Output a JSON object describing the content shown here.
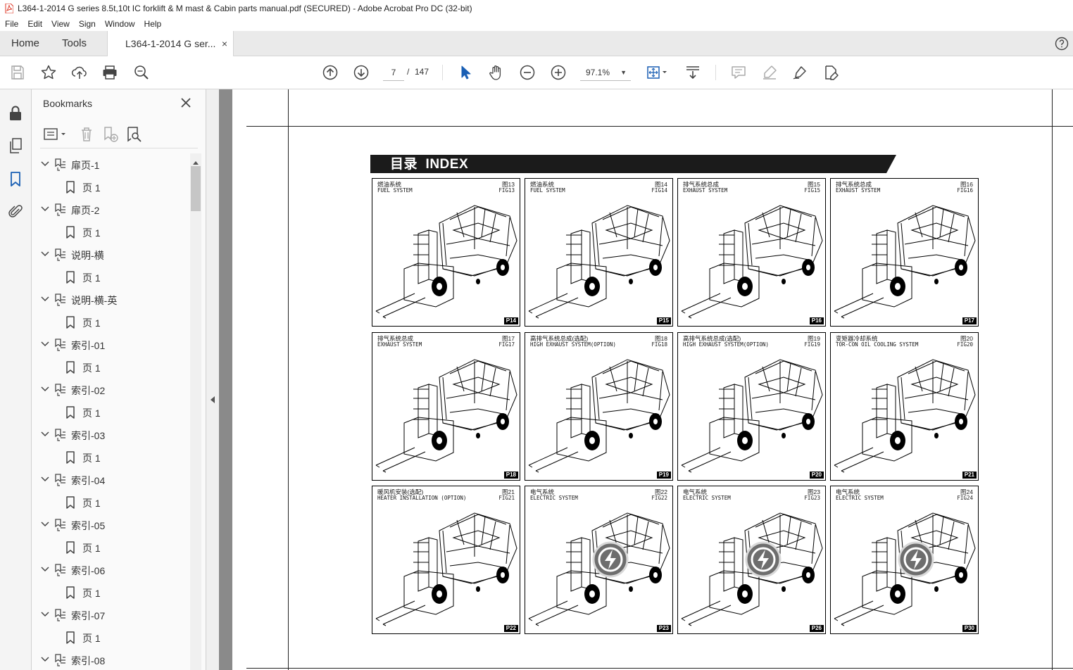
{
  "window": {
    "title": "L364-1-2014 G series 8.5t,10t IC forklift & M mast & Cabin parts manual.pdf (SECURED) - Adobe Acrobat Pro DC (32-bit)"
  },
  "menu": [
    "File",
    "Edit",
    "View",
    "Sign",
    "Window",
    "Help"
  ],
  "tabs": {
    "home": "Home",
    "tools": "Tools",
    "doc": "L364-1-2014 G ser...",
    "doc_close": "×"
  },
  "toolbar": {
    "page_current": "7",
    "page_separator": "/",
    "page_total": "147",
    "zoom": "97.1%"
  },
  "bookmarks": {
    "title": "Bookmarks",
    "items": [
      {
        "label": "扉页-1",
        "child": "页 1"
      },
      {
        "label": "扉页-2",
        "child": "页 1"
      },
      {
        "label": "说明-横",
        "child": "页 1"
      },
      {
        "label": "说明-横-英",
        "child": "页 1"
      },
      {
        "label": "索引-01",
        "child": "页 1"
      },
      {
        "label": "索引-02",
        "child": "页 1"
      },
      {
        "label": "索引-03",
        "child": "页 1"
      },
      {
        "label": "索引-04",
        "child": "页 1"
      },
      {
        "label": "索引-05",
        "child": "页 1"
      },
      {
        "label": "索引-06",
        "child": "页 1"
      },
      {
        "label": "索引-07",
        "child": "页 1"
      },
      {
        "label": "索引-08",
        "child": ""
      }
    ]
  },
  "document": {
    "index_title": "目录  INDEX",
    "figures": [
      {
        "cn": "燃油系统",
        "en": "FUEL SYSTEM",
        "fig_cn": "图13",
        "fig_en": "FIG13",
        "page": "P14",
        "electric": false
      },
      {
        "cn": "燃油系统",
        "en": "FUEL SYSTEM",
        "fig_cn": "图14",
        "fig_en": "FIG14",
        "page": "P15",
        "electric": false
      },
      {
        "cn": "排气系统总成",
        "en": "EXHAUST SYSTEM",
        "fig_cn": "图15",
        "fig_en": "FIG15",
        "page": "P16",
        "electric": false
      },
      {
        "cn": "排气系统总成",
        "en": "EXHAUST SYSTEM",
        "fig_cn": "图16",
        "fig_en": "FIG16",
        "page": "P17",
        "electric": false
      },
      {
        "cn": "排气系统总成",
        "en": "EXHAUST SYSTEM",
        "fig_cn": "图17",
        "fig_en": "FIG17",
        "page": "P18",
        "electric": false
      },
      {
        "cn": "高排气系统总成(选配)",
        "en": "HIGH EXHAUST SYSTEM(OPTION)",
        "fig_cn": "图18",
        "fig_en": "FIG18",
        "page": "P19",
        "electric": false
      },
      {
        "cn": "高排气系统总成(选配)",
        "en": "HIGH EXHAUST SYSTEM(OPTION)",
        "fig_cn": "图19",
        "fig_en": "FIG19",
        "page": "P20",
        "electric": false
      },
      {
        "cn": "变矩器冷却系统",
        "en": "TOR-CON OIL COOLING SYSTEM",
        "fig_cn": "图20",
        "fig_en": "FIG20",
        "page": "P21",
        "electric": false
      },
      {
        "cn": "暖风机安装(选配)",
        "en": "HEATER INSTALLATION (OPTION)",
        "fig_cn": "图21",
        "fig_en": "FIG21",
        "page": "P22",
        "electric": false
      },
      {
        "cn": "电气系统",
        "en": "ELECTRIC SYSTEM",
        "fig_cn": "图22",
        "fig_en": "FIG22",
        "page": "P23",
        "electric": true
      },
      {
        "cn": "电气系统",
        "en": "ELECTRIC SYSTEM",
        "fig_cn": "图23",
        "fig_en": "FIG23",
        "page": "P26",
        "electric": true
      },
      {
        "cn": "电气系统",
        "en": "ELECTRIC SYSTEM",
        "fig_cn": "图24",
        "fig_en": "FIG24",
        "page": "P30",
        "electric": true
      }
    ]
  },
  "icons": {
    "save": "save-icon",
    "star": "bookmark-star-icon",
    "upload": "upload-icon",
    "print": "print-icon",
    "search": "zoom-search-icon",
    "prev": "previous-page-icon",
    "next": "next-page-icon",
    "select": "select-cursor-icon",
    "hand": "hand-tool-icon",
    "zoom_out": "zoom-out-icon",
    "zoom_in": "zoom-in-icon",
    "fit": "fit-page-icon",
    "scroll": "scroll-mode-icon",
    "comment": "comment-icon",
    "highlight": "highlight-icon",
    "sign": "sign-icon",
    "edit": "edit-pdf-icon"
  }
}
